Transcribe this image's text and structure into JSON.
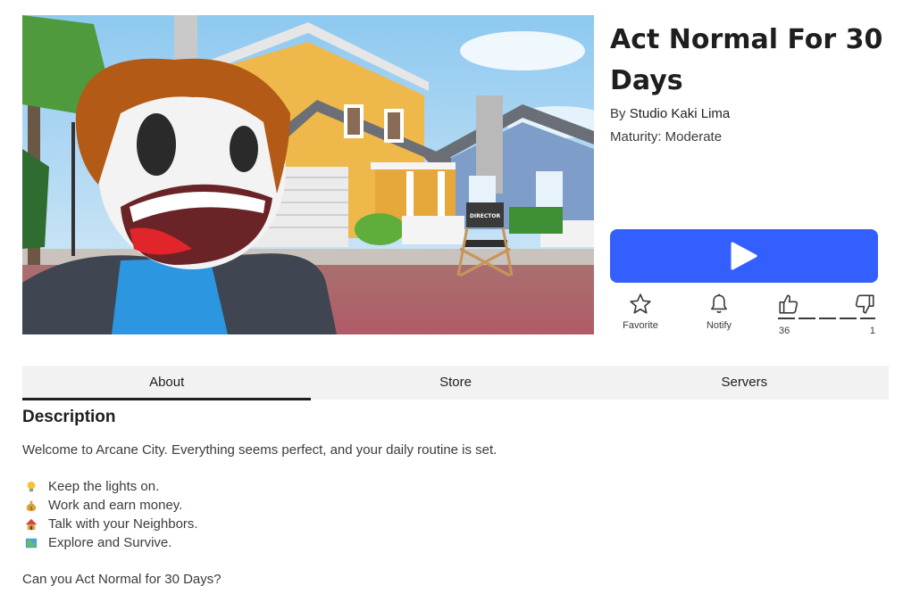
{
  "game": {
    "title": "Act Normal For 30 Days",
    "creator_prefix": "By",
    "creator": "Studio Kaki Lima",
    "maturity": "Maturity: Moderate"
  },
  "thumbnail": {
    "chair_text": "DIRECTOR"
  },
  "actions": {
    "favorite": "Favorite",
    "notify": "Notify",
    "upvotes": "36",
    "downvotes": "1"
  },
  "tabs": [
    "About",
    "Store",
    "Servers"
  ],
  "active_tab": "About",
  "description": {
    "heading": "Description",
    "intro": "Welcome to Arcane City. Everything seems perfect, and your daily routine is set.",
    "items": [
      {
        "icon": "lightbulb-icon",
        "text": "Keep the lights on."
      },
      {
        "icon": "money-bag-icon",
        "text": "Work and earn money."
      },
      {
        "icon": "house-icon",
        "text": "Talk with your Neighbors."
      },
      {
        "icon": "map-icon",
        "text": "Explore and Survive."
      }
    ],
    "closing": "Can you Act Normal for 30 Days?"
  },
  "colors": {
    "play_button": "#335fff",
    "tab_bg": "#f2f2f3",
    "text": "#393b3d"
  }
}
